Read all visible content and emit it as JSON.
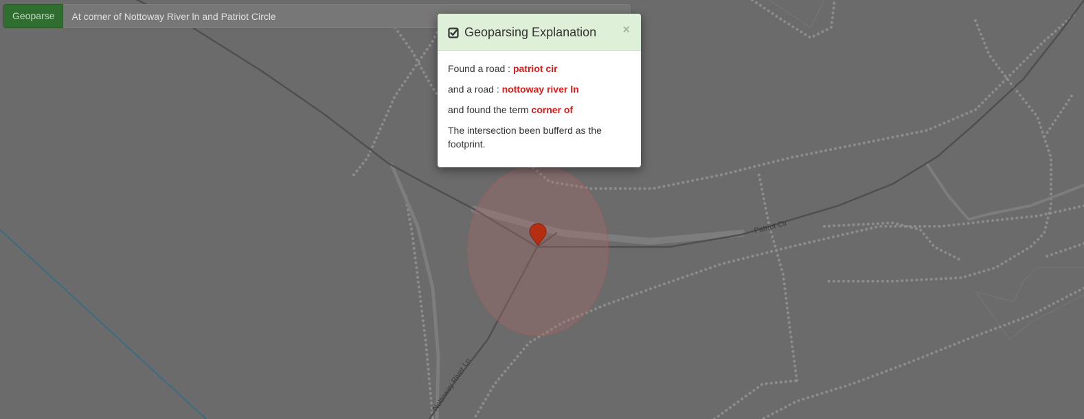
{
  "search": {
    "button_label": "Geoparse",
    "query": "At corner of Nottoway River ln and Patriot Circle"
  },
  "modal": {
    "title": "Geoparsing Explanation",
    "title_icon": "check-square-icon",
    "close_label": "×",
    "lines": [
      {
        "prefix": "Found a road : ",
        "highlight": "patriot cir"
      },
      {
        "prefix": "and a road : ",
        "highlight": "nottoway river ln"
      },
      {
        "prefix": "and found the term ",
        "highlight": "corner of"
      }
    ],
    "footer_text": "The intersection been bufferd as the footprint."
  },
  "map": {
    "labels": {
      "patriot": "Patriot Cir",
      "nottoway": "Nottoway River Ln"
    },
    "marker_icon": "map-pin-icon",
    "colors": {
      "background": "#6b6b6b",
      "road": "#555555",
      "road_casing": "#7a7a7a",
      "footpath": "#8a8a8a",
      "buffer_fill": "#a96a6a",
      "marker": "#b52e12",
      "water_line": "#3c6c82",
      "highlight_text": "#e01a1a",
      "modal_header": "#dff0d8",
      "button": "#2f6e2f"
    }
  }
}
